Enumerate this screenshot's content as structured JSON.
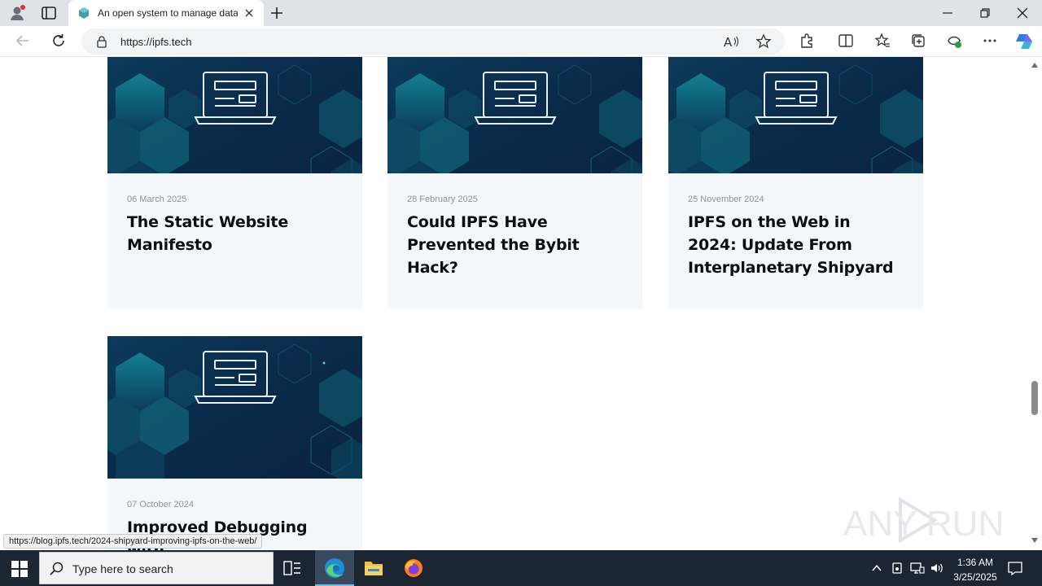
{
  "browser": {
    "tab_title": "An open system to manage data",
    "url": "https://ipfs.tech",
    "status_url": "https://blog.ipfs.tech/2024-shipyard-improving-ipfs-on-the-web/"
  },
  "posts": [
    {
      "date": "06 March 2025",
      "title": "The Static Website Manifesto"
    },
    {
      "date": "28 February 2025",
      "title": "Could IPFS Have Prevented the Bybit Hack?"
    },
    {
      "date": "25 November 2024",
      "title": "IPFS on the Web in 2024: Update From Interplanetary Shipyard"
    },
    {
      "date": "07 October 2024",
      "title": "Improved Debugging with"
    }
  ],
  "watermark": "ANY RUN",
  "taskbar": {
    "search_placeholder": "Type here to search",
    "time": "1:36 AM",
    "date": "3/25/2025"
  },
  "colors": {
    "card_image_dark": "#0b2240",
    "card_image_teal": "#0f6b7c",
    "card_body": "#f3f7fa",
    "taskbar": "#1c2633"
  }
}
